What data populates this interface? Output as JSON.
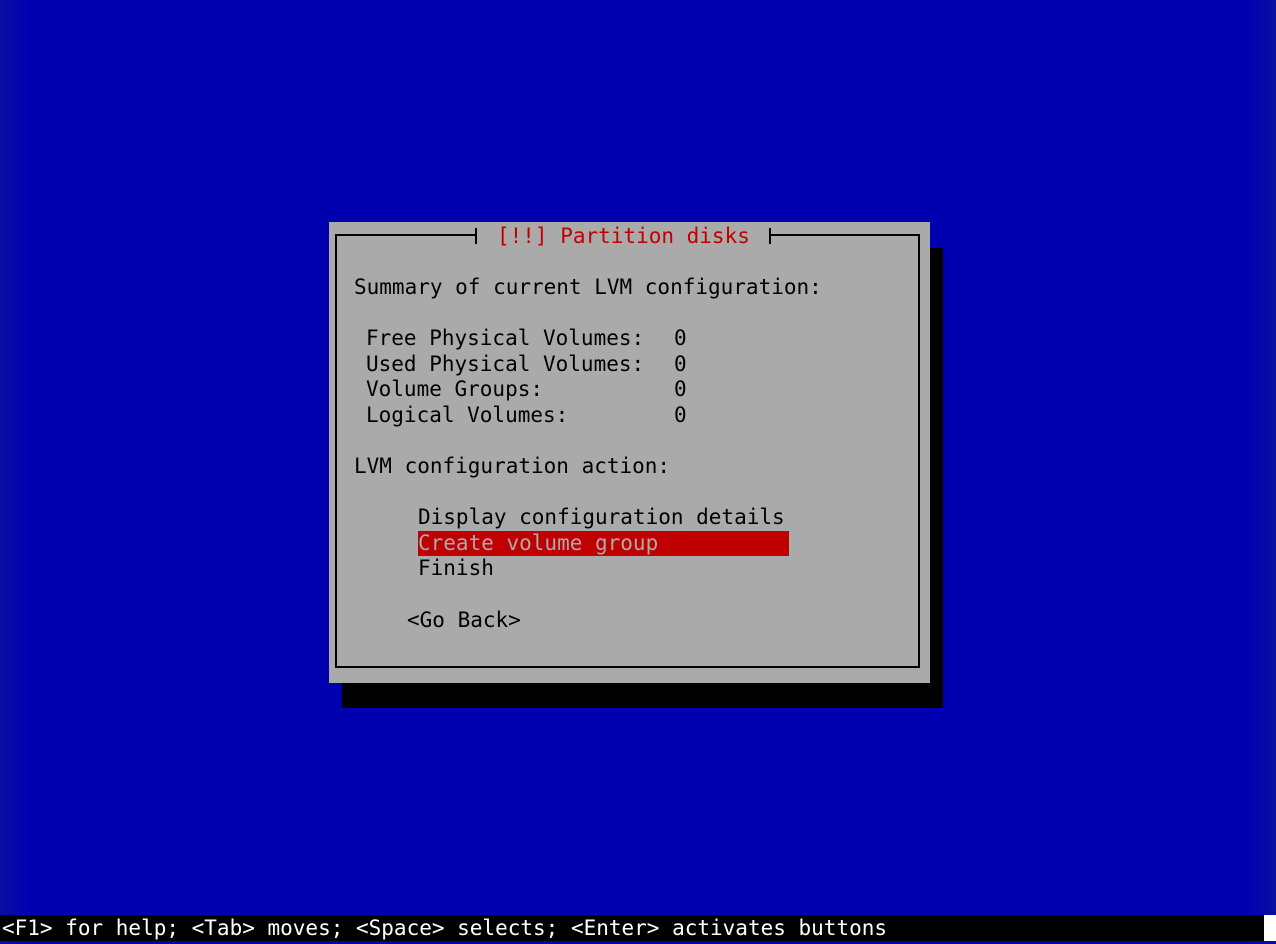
{
  "dialog": {
    "title": "[!!] Partition disks",
    "summary_heading": "Summary of current LVM configuration:",
    "stats": [
      {
        "label": "Free Physical Volumes:",
        "value": "0"
      },
      {
        "label": "Used Physical Volumes:",
        "value": "0"
      },
      {
        "label": "Volume Groups:",
        "value": "0"
      },
      {
        "label": "Logical Volumes:",
        "value": "0"
      }
    ],
    "action_heading": "LVM configuration action:",
    "menu": [
      {
        "label": "Display configuration details",
        "selected": false
      },
      {
        "label": "Create volume group",
        "selected": true
      },
      {
        "label": "Finish",
        "selected": false
      }
    ],
    "go_back_label": "<Go Back>"
  },
  "status_bar": {
    "text": "<F1> for help; <Tab> moves; <Space> selects; <Enter> activates buttons"
  },
  "colors": {
    "background": "#0000b0",
    "dialog": "#aaaaaa",
    "accent": "#c00000"
  }
}
